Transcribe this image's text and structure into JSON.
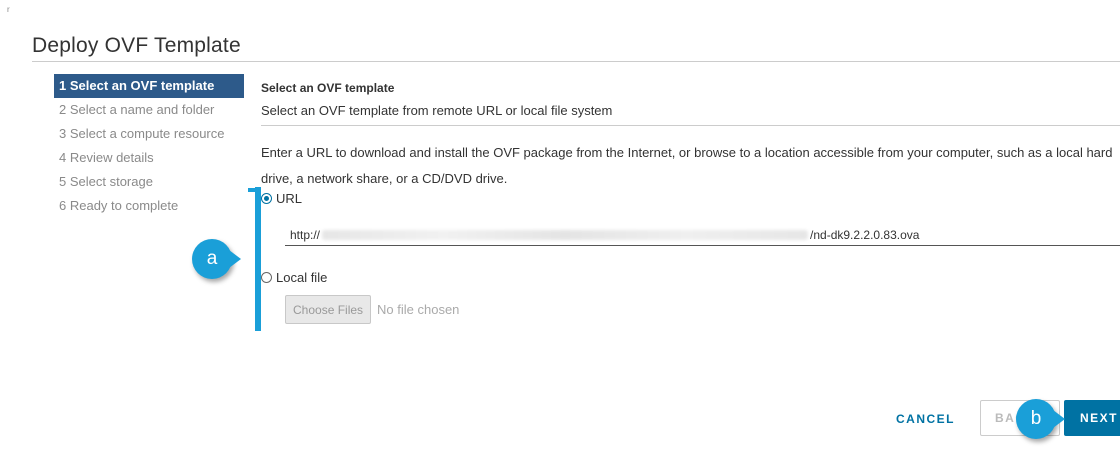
{
  "corner_mark": "r",
  "dialog": {
    "title": "Deploy OVF Template"
  },
  "steps": [
    {
      "label": "1 Select an OVF template",
      "active": true
    },
    {
      "label": "2 Select a name and folder",
      "active": false
    },
    {
      "label": "3 Select a compute resource",
      "active": false
    },
    {
      "label": "4 Review details",
      "active": false
    },
    {
      "label": "5 Select storage",
      "active": false
    },
    {
      "label": "6 Ready to complete",
      "active": false
    }
  ],
  "content": {
    "title": "Select an OVF template",
    "subtitle": "Select an OVF template from remote URL or local file system",
    "description": "Enter a URL to download and install the OVF package from the Internet, or browse to a location accessible from your computer, such as a local hard drive, a network share, or a CD/DVD drive.",
    "url_option": {
      "label": "URL",
      "selected": true
    },
    "url_value": {
      "prefix": "http://",
      "suffix": "/nd-dk9.2.2.0.83.ova"
    },
    "local_option": {
      "label": "Local file",
      "selected": false
    },
    "choose_files_label": "Choose Files",
    "no_file_label": "No file chosen"
  },
  "annotations": {
    "a": "a",
    "b": "b"
  },
  "footer": {
    "cancel": "CANCEL",
    "back": "BACK",
    "next": "NEXT"
  },
  "colors": {
    "accent": "#0072a3",
    "active_step": "#2d5a8a",
    "annotation": "#1a9fd8"
  }
}
